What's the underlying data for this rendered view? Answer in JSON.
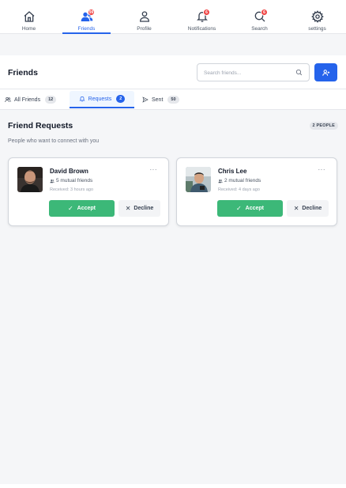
{
  "nav": {
    "items": [
      {
        "label": "Home",
        "icon": "home-icon",
        "badge": ""
      },
      {
        "label": "Friends",
        "icon": "friends-icon",
        "badge": "99"
      },
      {
        "label": "Profile",
        "icon": "profile-icon",
        "badge": ""
      },
      {
        "label": "Notifications",
        "icon": "bell-icon",
        "badge": "6"
      },
      {
        "label": "Search",
        "icon": "search-icon",
        "badge": "6"
      },
      {
        "label": "settings",
        "icon": "gear-icon",
        "badge": ""
      }
    ],
    "active": "Friends"
  },
  "header": {
    "title": "Friends",
    "search_placeholder": "Search friends..."
  },
  "tabs": [
    {
      "label": "All Friends",
      "count": "12"
    },
    {
      "label": "Requests",
      "count": "2"
    },
    {
      "label": "Sent",
      "count": "50"
    }
  ],
  "section": {
    "title": "Friend Requests",
    "count": "2 PEOPLE",
    "subtitle": "People who want to connect with you"
  },
  "requests": [
    {
      "name": "David Brown",
      "mutual": "5 mutual friends",
      "received": "Received: 3 hours ago",
      "more": "···",
      "accept": "Accept",
      "decline": "Decline"
    },
    {
      "name": "Chris Lee",
      "mutual": "2 mutual friends",
      "received": "Received: 4 days ago",
      "more": "···",
      "accept": "Accept",
      "decline": "Decline"
    }
  ],
  "colors": {
    "accent": "#2563eb",
    "accept": "#3cb878",
    "badge": "#ef4444"
  }
}
